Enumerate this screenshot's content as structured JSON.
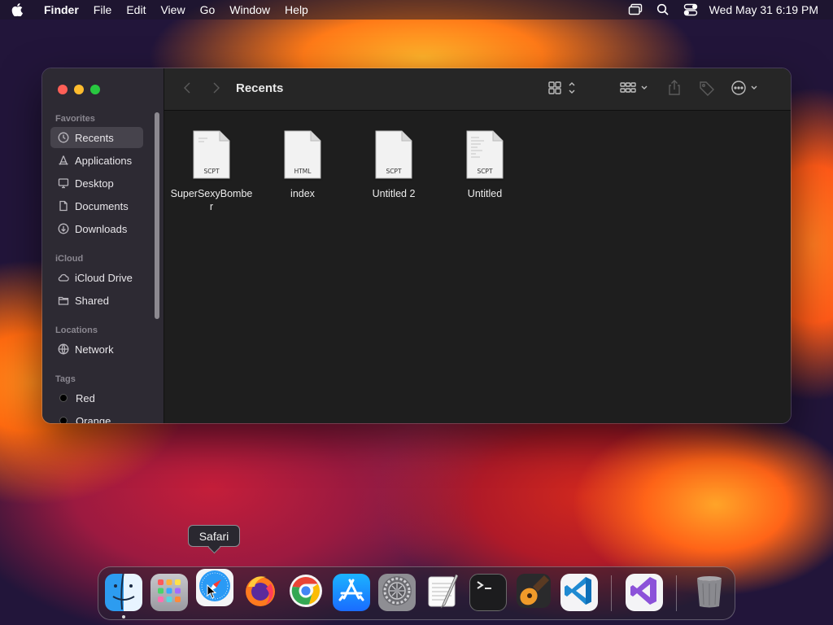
{
  "menubar": {
    "app_name": "Finder",
    "menus": [
      "File",
      "Edit",
      "View",
      "Go",
      "Window",
      "Help"
    ],
    "clock": "Wed May 31  6:19 PM",
    "status_icons": [
      "screen-mirroring-icon",
      "search-icon",
      "control-center-icon"
    ]
  },
  "window": {
    "title": "Recents",
    "sidebar": {
      "favorites_label": "Favorites",
      "favorites": [
        {
          "label": "Recents",
          "icon": "clock-icon",
          "selected": true
        },
        {
          "label": "Applications",
          "icon": "applications-icon"
        },
        {
          "label": "Desktop",
          "icon": "desktop-icon"
        },
        {
          "label": "Documents",
          "icon": "document-icon"
        },
        {
          "label": "Downloads",
          "icon": "download-icon"
        }
      ],
      "icloud_label": "iCloud",
      "icloud": [
        {
          "label": "iCloud Drive",
          "icon": "cloud-icon"
        },
        {
          "label": "Shared",
          "icon": "shared-folder-icon"
        }
      ],
      "locations_label": "Locations",
      "locations": [
        {
          "label": "Network",
          "icon": "globe-icon"
        }
      ],
      "tags_label": "Tags",
      "tags": [
        {
          "label": "Red"
        },
        {
          "label": "Orange"
        }
      ]
    },
    "files": [
      {
        "name": "SuperSexyBomber",
        "ext": "SCPT"
      },
      {
        "name": "index",
        "ext": "HTML"
      },
      {
        "name": "Untitled 2",
        "ext": "SCPT"
      },
      {
        "name": "Untitled",
        "ext": "SCPT"
      }
    ]
  },
  "dock": {
    "tooltip": "Safari",
    "apps": [
      "Finder",
      "Launchpad",
      "Safari",
      "Firefox",
      "Google Chrome",
      "App Store",
      "System Settings",
      "TextEdit",
      "Terminal",
      "GarageBand",
      "Visual Studio Code",
      "Visual Studio",
      "Trash"
    ],
    "colors": {
      "finder": "#2d9cf0",
      "vscode": "#1f8ad2",
      "appstore": "#1a8cff"
    }
  }
}
